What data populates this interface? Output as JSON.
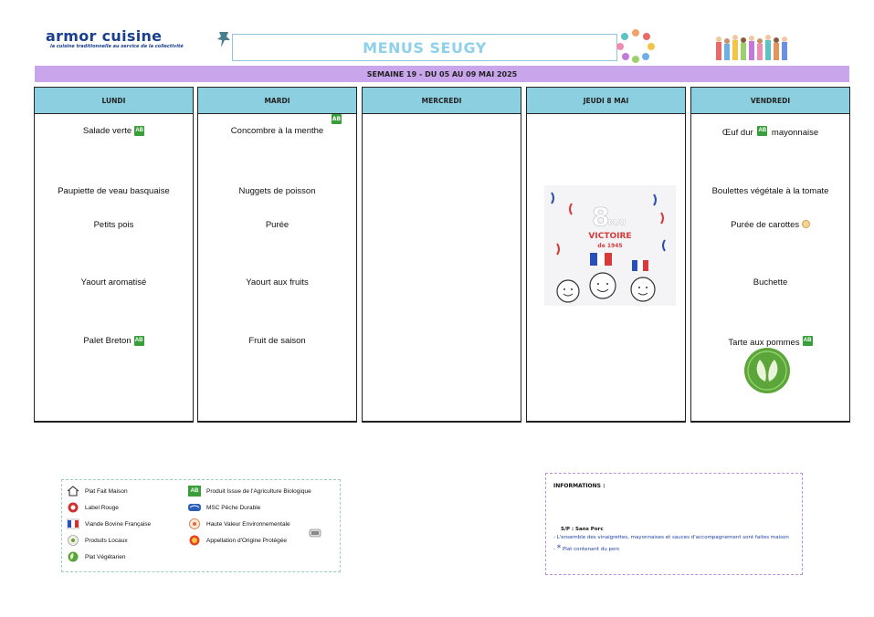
{
  "header": {
    "brand": "armor cuisine",
    "tagline": "la cuisine traditionnelle au service de la collectivité",
    "title": "MENUS SEUGY",
    "week": "SEMAINE 19  - DU 05 AU 09 MAI 2025"
  },
  "bio_label": "AB",
  "days": [
    {
      "name": "LUNDI",
      "dishes": [
        "Salade verte",
        "Paupiette de veau basquaise",
        "Petits pois",
        "Yaourt aromatisé",
        "Palet Breton"
      ]
    },
    {
      "name": "MARDI",
      "dishes": [
        "Concombre à la menthe",
        "Nuggets de poisson",
        "Purée",
        "Yaourt aux fruits",
        "Fruit de saison"
      ]
    },
    {
      "name": "MERCREDI",
      "dishes": []
    },
    {
      "name": "JEUDI 8 MAI",
      "dishes": []
    },
    {
      "name": "VENDREDI",
      "dishes": [
        "Œuf dur",
        "mayonnaise",
        "Boulettes végétale à la tomate",
        "Purée de carottes",
        "Buchette",
        "Tarte aux pommes"
      ]
    }
  ],
  "victory": {
    "day": "8",
    "month": "MAI",
    "line1": "VICTOIRE",
    "line2": "de 1945"
  },
  "legend": [
    {
      "label": "Plat Fait Maison",
      "icon": "house-icon"
    },
    {
      "label": "Label Rouge",
      "icon": "label-rouge-icon"
    },
    {
      "label": "Viande Bovine Française",
      "icon": "vbf-icon"
    },
    {
      "label": "Produits Locaux",
      "icon": "local-products-icon"
    },
    {
      "label": "Plat Végétarien",
      "icon": "leaf-icon"
    },
    {
      "label": "Produit Issue de l'Agriculture Biologique",
      "icon": "ab-icon"
    },
    {
      "label": "MSC Pêche Durable",
      "icon": "msc-icon"
    },
    {
      "label": "Haute Valeur Environnementale",
      "icon": "hve-icon"
    },
    {
      "label": "Appellation d'Origine Protégée",
      "icon": "aop-icon"
    }
  ],
  "info": {
    "title": "INFORMATIONS :",
    "sp": "S/P : Sans Porc",
    "line1": "- L'ensemble des vinaigrettes, mayonnaises et sauces d'accompagnement sont faites maison",
    "line2_star": "*",
    "line2": "Plat contenant du porc"
  },
  "colors": {
    "week_bar": "#c9a5ec",
    "col_head": "#8ccfe0",
    "title": "#8fd0ea",
    "brand": "#1b3f8f",
    "bio": "#3a9e3a"
  }
}
